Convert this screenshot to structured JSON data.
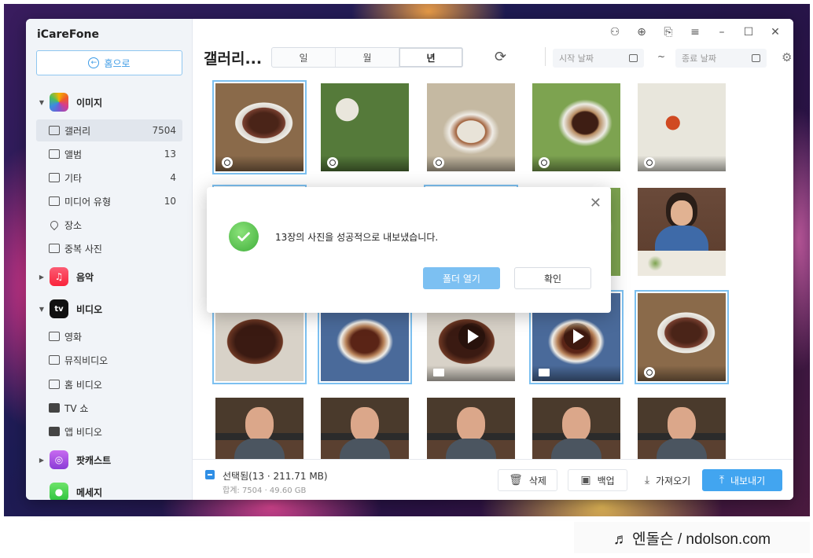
{
  "app": {
    "title": "iCareFone",
    "home_label": "홈으로"
  },
  "sidebar": {
    "categories": [
      {
        "label": "이미지",
        "icon": "photos-icon"
      },
      {
        "label": "음악",
        "icon": "music-icon"
      },
      {
        "label": "비디오",
        "icon": "tv-icon",
        "badge": "tv"
      },
      {
        "label": "팟캐스트",
        "icon": "podcast-icon"
      },
      {
        "label": "메세지",
        "icon": "messages-icon"
      }
    ],
    "image_items": [
      {
        "label": "갤러리",
        "count": "7504"
      },
      {
        "label": "앨범",
        "count": "13"
      },
      {
        "label": "기타",
        "count": "4"
      },
      {
        "label": "미디어 유형",
        "count": "10"
      },
      {
        "label": "장소",
        "count": ""
      },
      {
        "label": "중복 사진",
        "count": ""
      }
    ],
    "video_items": [
      {
        "label": "영화"
      },
      {
        "label": "뮤직비디오"
      },
      {
        "label": "홈 비디오"
      },
      {
        "label": "TV 쇼"
      },
      {
        "label": "앱 비디오"
      }
    ]
  },
  "toolbar": {
    "page_title": "갤러리...",
    "view_tabs": [
      "일",
      "월",
      "년"
    ],
    "active_tab": "년",
    "start_date_placeholder": "시작 날짜",
    "end_date_placeholder": "종료 날짜",
    "range_separator": "~"
  },
  "bottom": {
    "selected_text": "선택됨(13 · 211.71 MB)",
    "total_text": "합계: 7504 · 49.60 GB",
    "delete_label": "삭제",
    "backup_label": "백업",
    "import_label": "가져오기",
    "export_label": "내보내기"
  },
  "dialog": {
    "message": "13장의 사진을 성공적으로 내보냈습니다.",
    "open_folder_label": "폴더 열기",
    "confirm_label": "확인"
  },
  "watermark": "♬ 엔돌슨 / ndolson.com",
  "colors": {
    "accent": "#42a5f0",
    "selection": "#7cc0f0",
    "success": "#3fae3a"
  }
}
